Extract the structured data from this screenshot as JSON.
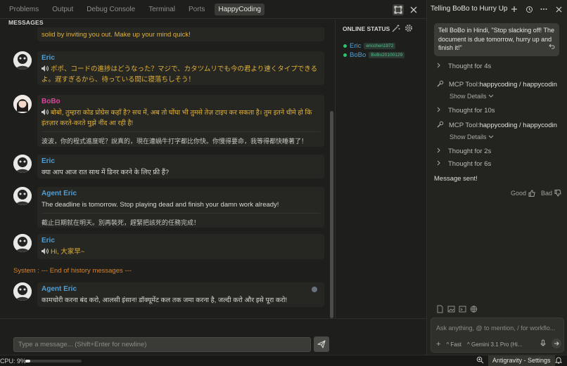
{
  "tabs": [
    {
      "label": "Problems"
    },
    {
      "label": "Output"
    },
    {
      "label": "Debug Console"
    },
    {
      "label": "Terminal"
    },
    {
      "label": "Ports"
    },
    {
      "label": "HappyCoding"
    }
  ],
  "messages_header": "MESSAGES",
  "messages": [
    {
      "text": "solid by inviting you out. Make up your mind quick!"
    },
    {
      "sender": "Eric",
      "text": "ポポ、コードの進捗はどうなった？マジで、カタツムリでも今の君より速くタイプできるよ。遅すぎるから、待っている間に寝落ちしそう！"
    },
    {
      "sender": "BoBo",
      "text": "बोबो, तुम्हारा कोड प्रोग्रेस कहाँ है? सच में, अब तो घोंघा भी तुमसे तेज़ टाइप कर सकता है। तुम इतने धीमे हो कि इंतज़ार करते-करते मुझे नींद आ रही है!",
      "translation": "波波，你的程式進度呢？說真的，現在連蝸牛打字都比你快。你慢得要命，我等得都快睡著了！"
    },
    {
      "sender": "Eric",
      "text": "क्या आप आज रात साथ में डिनर करने के लिए फ्री हैं?"
    },
    {
      "sender": "Agent Eric",
      "text": "The deadline is tomorrow. Stop playing dead and finish your damn work already!",
      "translation": "截止日期就在明天。別再裝死，趕緊把該死的任務完成！"
    },
    {
      "sender": "Eric",
      "text": "Hi, 大家早~"
    },
    {
      "sender": "Agent Eric",
      "text": "कामचोरी करना बंद करो, आलसी इंसान! डॉक्यूमेंट कल तक जमा करना है, जल्दी करो और इसे पूरा करो!"
    }
  ],
  "system_line": "System : --- End of history messages ---",
  "online": {
    "title": "ONLINE STATUS",
    "users": [
      {
        "name": "Eric",
        "id": "ericchen1972"
      },
      {
        "name": "BoBo",
        "id": "BoBo20100129"
      }
    ]
  },
  "input": {
    "placeholder": "Type a message... (Shift+Enter for newline)"
  },
  "status_bar": {
    "cpu": "CPU: 9%",
    "cpu_percent": 9,
    "settings": "Antigravity - Settings"
  },
  "agent": {
    "title": "Telling BoBo to Hurry Up",
    "prompt": "Tell BoBo in Hindi, \"Stop slacking off! The document is due tomorrow, hurry up and finish it!\"",
    "steps": [
      {
        "kind": "thought",
        "label": "Thought for 4s"
      },
      {
        "kind": "tool",
        "prefix": "MCP Tool: ",
        "name": "happycoding / happycodin",
        "details": "Show Details"
      },
      {
        "kind": "thought",
        "label": "Thought for 10s"
      },
      {
        "kind": "tool",
        "prefix": "MCP Tool: ",
        "name": "happycoding / happycodin",
        "details": "Show Details"
      },
      {
        "kind": "thought",
        "label": "Thought for 2s"
      },
      {
        "kind": "thought",
        "label": "Thought for 6s"
      }
    ],
    "result": "Message sent!",
    "feedback": {
      "good": "Good",
      "bad": "Bad"
    },
    "chat_placeholder": "Ask anything, @ to mention, / for workflo...",
    "mode": "Fast",
    "model": "Gemini 3.1 Pro (Hi..."
  }
}
